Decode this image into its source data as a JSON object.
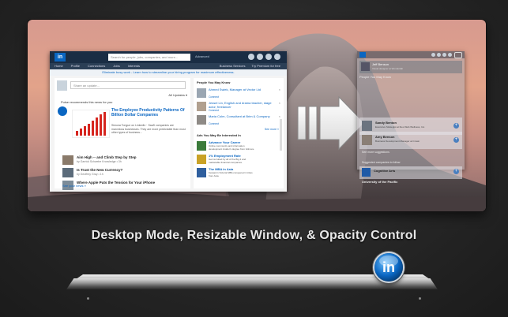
{
  "caption": "Desktop Mode, Resizable Window, & Opacity Control",
  "app_icon": {
    "glyph": "in"
  },
  "left_window": {
    "logo": "in",
    "search_placeholder": "Search for people, jobs, companies, and more...",
    "advanced": "Advanced",
    "nav": [
      "Home",
      "Profile",
      "Connections",
      "Jobs",
      "Interests"
    ],
    "nav_right": [
      "Business Services",
      "Try Premium for free"
    ],
    "promo": "Eliminate busy work - Learn how to streamline your hiring program for maximum effectiveness.",
    "share_placeholder": "Share an update...",
    "all_updates": "All Updates ▾",
    "pulse_heading": "Pulse recommends this news for you",
    "article_title": "The Employee Productivity Patterns Of Billion Dollar Companies",
    "article_body": "Simona Tongue on LinkedIn · SaaS companies are marvelous businesses. They are more predictable than most other types of business...",
    "news": [
      {
        "title": "Aim High -- and Climb Step by Step",
        "src": "by Garrick Schwebe Knowledge • 3h"
      },
      {
        "title": "Is Trust the New Currency?",
        "src": "by Geoffrey Gray • 1h"
      },
      {
        "title": "Where Apple Puts the Tension for Your iPhone",
        "src": ""
      }
    ],
    "see_news": "See your news »",
    "pymk_heading": "People You May Know",
    "people": [
      {
        "name": "Ahmed Swiek, Manager at Vector Ltd",
        "action": "Connect"
      },
      {
        "name": "Jessel Lin, English and drama teacher, stage actor, freelancer",
        "action": "Connect"
      },
      {
        "name": "Maria Colm, Consultant at Brim & Company",
        "action": "Connect"
      }
    ],
    "see_more": "See more »",
    "ads_heading": "Ads You May Be Interested In",
    "ads": [
      {
        "title": "Advance Your Career",
        "desc": "Online community and information development insider's degree from Gilmore."
      },
      {
        "title": "1% Employment Rate",
        "desc": "Get recruited by all of the Big 4 and marketable financial companies."
      },
      {
        "title": "The MBA in Asia",
        "desc": "Kenjamin Victoria MBA conquered 4 cities from Asia."
      }
    ]
  },
  "right_window": {
    "user_name": "Jeff Benson",
    "user_sub": "Visual designer at Wonderlab",
    "pymk_heading": "People You May Know",
    "people": [
      {
        "name": "Sandy Benton",
        "sub": "Executive Strategist at Ibeo Web Wellness, Inc."
      },
      {
        "name": "Amy Benson",
        "sub": "Business Development Manager at Crown"
      }
    ],
    "see_more": "See more suggestions",
    "sugg_heading": "Suggested companies to follow",
    "company": "Cognitive Arts",
    "last": "University of the Pacific"
  }
}
